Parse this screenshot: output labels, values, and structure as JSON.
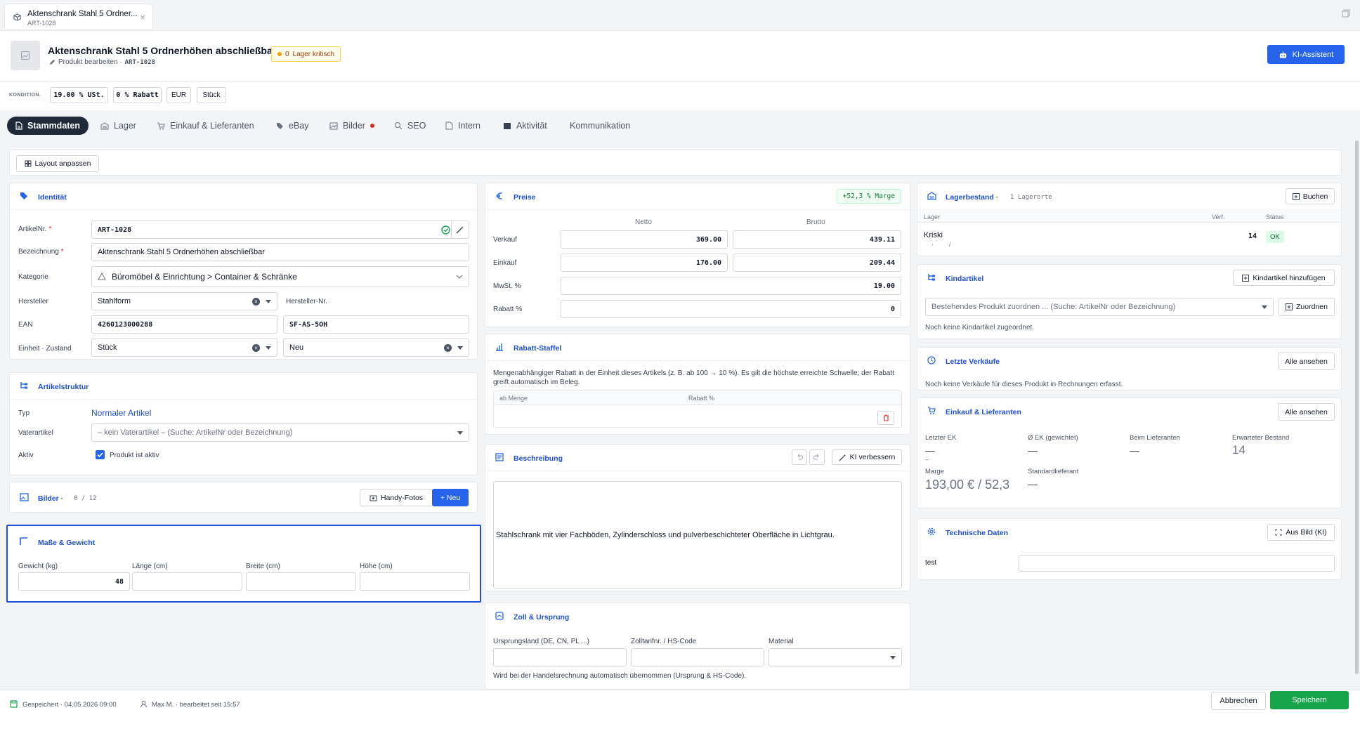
{
  "window_tab": {
    "title": "Aktenschrank Stahl 5 Ordner...",
    "subtitle": "ART-1028",
    "close": "×"
  },
  "header": {
    "title": "Aktenschrank Stahl 5 Ordnerhöhen abschließbar",
    "edit_label": "Produkt bearbeiten ·",
    "sku": "ART-1028",
    "stock_count": "0",
    "stock_label": "Lager kritisch",
    "ki_button": "KI-Assistent"
  },
  "konditionen": {
    "label": "KONDITION.",
    "chips": [
      "19.00 % USt.",
      "0 % Rabatt",
      "EUR",
      "Stück"
    ]
  },
  "nav": {
    "tabs": [
      "Stammdaten",
      "Lager",
      "Einkauf & Lieferanten",
      "eBay",
      "Bilder",
      "SEO",
      "Intern",
      "Aktivität",
      "Kommunikation"
    ]
  },
  "layout_button": "Layout anpassen",
  "identitaet": {
    "title": "Identität",
    "artikelnr_label": "ArtikelNr.",
    "artikelnr": "ART-1028",
    "bezeichnung_label": "Bezeichnung",
    "bezeichnung": "Aktenschrank Stahl 5 Ordnerhöhen abschließbar",
    "kategorie_label": "Kategorie",
    "kategorie": "Büromöbel & Einrichtung > Container & Schränke",
    "hersteller_label": "Hersteller",
    "hersteller": "Stahlform",
    "herstellernr_label": "Hersteller-Nr.",
    "ean_label": "EAN",
    "ean": "4260123000288",
    "ean2": "SF-AS-5OH",
    "einheit_label": "Einheit · Zustand",
    "einheit": "Stück",
    "zustand": "Neu",
    "required_mark": "*"
  },
  "artikelstruktur": {
    "title": "Artikelstruktur",
    "typ_label": "Typ",
    "typ": "Normaler Artikel",
    "vater_label": "Vaterartikel",
    "vater_placeholder": "– kein Vaterartikel – (Suche: ArtikelNr oder Bezeichnung)",
    "aktiv_label": "Aktiv",
    "aktiv_text": "Produkt ist aktiv"
  },
  "bilder": {
    "title": "Bilder ·",
    "count": "0 / 12",
    "handy": "Handy-Fotos",
    "neu": "+ Neu"
  },
  "masse": {
    "title": "Maße & Gewicht",
    "gewicht_label": "Gewicht (kg)",
    "gewicht": "48",
    "laenge_label": "Länge (cm)",
    "breite_label": "Breite (cm)",
    "hoehe_label": "Höhe (cm)"
  },
  "preise": {
    "title": "Preise",
    "marge": "+52,3 % Marge",
    "netto": "Netto",
    "brutto": "Brutto",
    "verkauf_label": "Verkauf",
    "verkauf_netto": "369.00",
    "verkauf_brutto": "439.11",
    "einkauf_label": "Einkauf",
    "einkauf_netto": "176.00",
    "einkauf_brutto": "209.44",
    "mwst_label": "MwSt. %",
    "mwst": "19.00",
    "rabatt_label": "Rabatt %",
    "rabatt": "0"
  },
  "staffel": {
    "title": "Rabatt-Staffel",
    "desc": "Mengenabhängiger Rabatt in der Einheit dieses Artikels (z. B. ab 100 → 10 %). Es gilt die höchste erreichte Schwelle; der Rabatt greift automatisch im Beleg.",
    "col1": "ab Menge",
    "col2": "Rabatt %"
  },
  "beschreibung": {
    "title": "Beschreibung",
    "ki": "KI verbessern",
    "text": "Stahlschrank mit vier Fachböden, Zylinderschloss und pulverbeschichteter Oberfläche in Lichtgrau."
  },
  "zoll": {
    "title": "Zoll & Ursprung",
    "land_label": "Ursprungsland (DE, CN, PL ...)",
    "tarif_label": "Zolltarifnr. / HS-Code",
    "material_label": "Material",
    "hint": "Wird bei der Handelsrechnung automatisch übernommen (Ursprung & HS-Code)."
  },
  "lager": {
    "title": "Lagerbestand ·",
    "orte": "1 Lagerorte",
    "buchen": "Buchen",
    "col_lager": "Lager",
    "col_verf": "Verf.",
    "col_status": "Status",
    "row_name": "Kriski",
    "row_sub1": "·",
    "row_sub2": "/",
    "row_verf": "14",
    "row_status": "OK"
  },
  "kind": {
    "title": "Kindartikel",
    "add": "Kindartikel hinzufügen",
    "placeholder": "Bestehendes Produkt zuordnen ... (Suche: ArtikelNr oder Bezeichnung)",
    "zuordnen": "Zuordnen",
    "empty": "Noch keine Kindartikel zugeordnet."
  },
  "verkaeufe": {
    "title": "Letzte Verkäufe",
    "all": "Alle ansehen",
    "empty": "Noch keine Verkäufe für dieses Produkt in Rechnungen erfasst."
  },
  "einkauf": {
    "title": "Einkauf & Lieferanten",
    "all": "Alle ansehen",
    "letzter_label": "Letzter EK",
    "letzter": "—",
    "letzter_sub": "–",
    "ek_label": "Ø EK (gewichtet)",
    "ek": "—",
    "lief_label": "Beim Lieferanten",
    "lief": "—",
    "erw_label": "Erwarteter Bestand",
    "erw": "14",
    "marge_label": "Marge",
    "marge": "193,00 € / 52,3",
    "std_label": "Standardlieferant",
    "std": "—"
  },
  "technik": {
    "title": "Technische Daten",
    "aus_bild": "Aus Bild (KI)",
    "row_label": "test"
  },
  "footer": {
    "saved": "Gespeichert · 04.05.2026 09:00",
    "user": "Max M. · bearbeitet seit 15:57",
    "cancel": "Abbrechen",
    "save": "Speichern"
  },
  "colors": {
    "accent": "#2563eb",
    "success": "#16a34a",
    "danger": "#dc2626",
    "nav_active": "#1f2937",
    "highlight_border": "#1d4ed8"
  }
}
